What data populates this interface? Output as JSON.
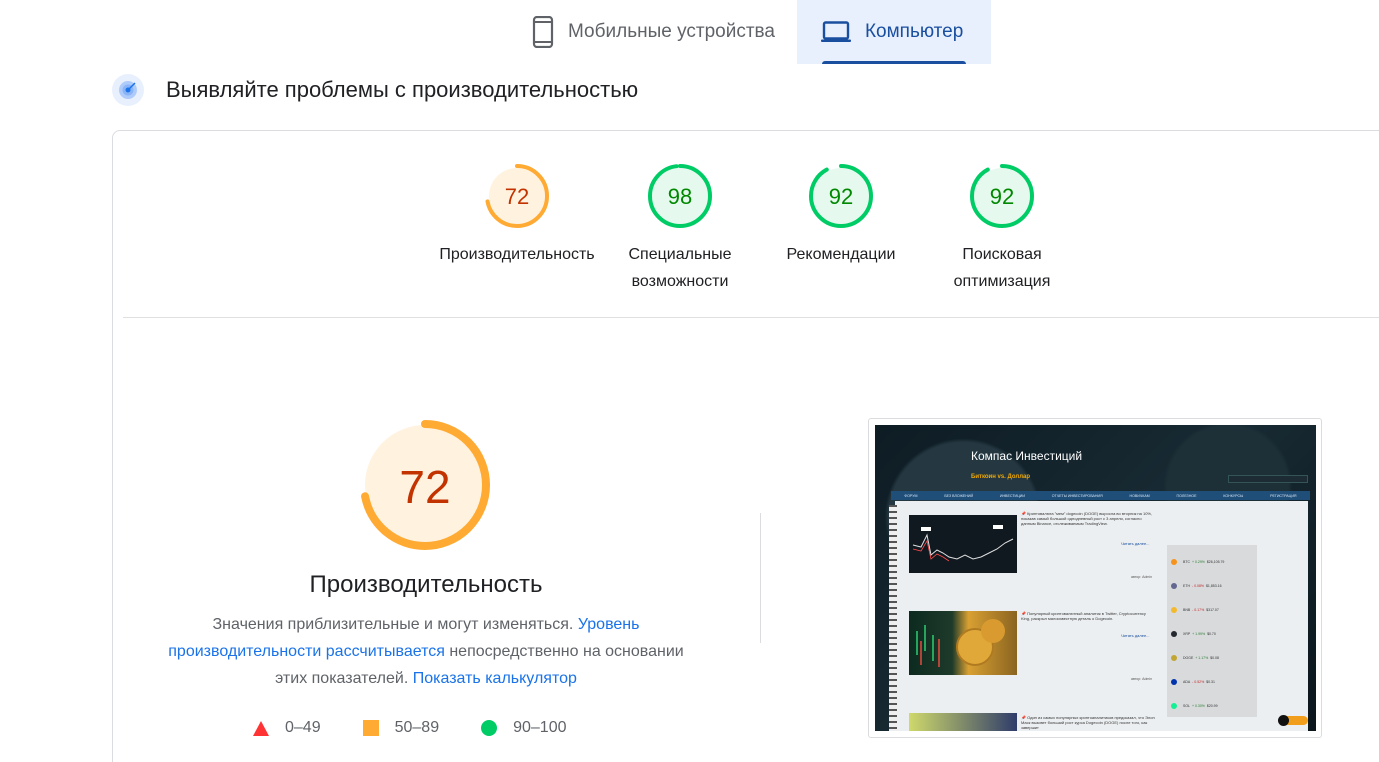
{
  "tabs": [
    {
      "label": "Мобильные устройства",
      "icon": "smartphone-icon",
      "active": false
    },
    {
      "label": "Компьютер",
      "icon": "laptop-icon",
      "active": true
    }
  ],
  "section": {
    "title": "Выявляйте проблемы с производительностью",
    "icon": "radar-icon"
  },
  "scores": [
    {
      "value": "72",
      "label": "Производительность",
      "status": "average",
      "color": "#fa3"
    },
    {
      "value": "98",
      "label": "Специальные возможности",
      "status": "pass",
      "color": "#0c6"
    },
    {
      "value": "92",
      "label": "Рекомендации",
      "status": "pass",
      "color": "#0c6"
    },
    {
      "value": "92",
      "label": "Поисковая оптимизация",
      "status": "pass",
      "color": "#0c6"
    }
  ],
  "performance": {
    "score": "72",
    "title": "Производительность",
    "desc_1": "Значения приблизительные и могут изменяться. ",
    "link_1": "Уровень производительности рассчитывается",
    "desc_2": " непосредственно на основании этих показателей. ",
    "link_2": "Показать калькулятор"
  },
  "legend": [
    {
      "range": "0–49",
      "shape": "triangle",
      "color": "#ff3333"
    },
    {
      "range": "50–89",
      "shape": "square",
      "color": "#ffaa33"
    },
    {
      "range": "90–100",
      "shape": "circle",
      "color": "#00cc66"
    }
  ],
  "preview": {
    "site_title": "Компас Инвестиций",
    "subtitle": "Биткоин vs. Доллар",
    "nav": [
      "ФОРУМ",
      "БЕЗ ВЛОЖЕНИЙ",
      "ИНВЕСТИЦИИ",
      "ОТЧЕТЫ ИНВЕСТИРОВАНИЯ",
      "НОВИЧКАМ",
      "ПОЛЕЗНОЕ",
      "КОНКУРСЫ",
      "РЕГИСТРАЦИЯ"
    ],
    "post_1": "📌 Криптовалюта \"мем\" dogecoin (DOGE) выросла во вторник на 10%, показав самый большой однодневный рост с 3 апреля, согласно данным Binance, отслеживаемым TradingView.",
    "post_2": "📌 Популярный криптовалютный аналитик в Twitter, Cryptocurrency King, раскрыл малоизвестную деталь о Dogecoin.",
    "post_3": "📌 Один из самых популярных криптоаналитиков предсказал, что Элон Маск вызовет больший рост курса Dogecoin (DOGE) после того, как завершит",
    "read_more": "Читать далее...",
    "author": "автор: Admin",
    "coins": [
      {
        "name": "BTC",
        "change": "+ 0.29%",
        "price": "$26,105.79",
        "color": "#f7931a"
      },
      {
        "name": "ETH",
        "change": "- 0.08%",
        "price": "$1,853.16",
        "color": "#62688f"
      },
      {
        "name": "BNB",
        "change": "- 0.17%",
        "price": "$317.07",
        "color": "#f3ba2f"
      },
      {
        "name": "XRP",
        "change": "+ 1.99%",
        "price": "$0.70",
        "color": "#23292f"
      },
      {
        "name": "DOGE",
        "change": "+ 1.17%",
        "price": "$0.08",
        "color": "#c2a633"
      },
      {
        "name": "ADA",
        "change": "- 0.52%",
        "price": "$0.31",
        "color": "#0033ad"
      },
      {
        "name": "SOL",
        "change": "+ 0.30%",
        "price": "$20.99",
        "color": "#14f195"
      }
    ]
  }
}
